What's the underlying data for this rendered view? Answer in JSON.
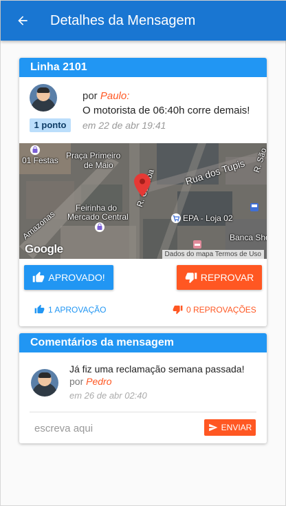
{
  "header": {
    "title": "Detalhes da Mensagem",
    "back_icon": "arrow-back-icon"
  },
  "message_card": {
    "title": "Linha 2101",
    "points_badge": "1 ponto",
    "by_prefix": "por",
    "author": "Paulo:",
    "text": "O motorista de 06:40h corre demais!",
    "date": "em 22 de abr 19:41",
    "map": {
      "labels": {
        "festas": "01 Festas",
        "praca": "Praça Primeiro",
        "praca2": "de Maio",
        "tupis": "Rua dos Tupis",
        "feirinha": "Feirinha do",
        "mercado": "Mercado Central",
        "curitiba": "R. Curitiba",
        "epa": "EPA - Loja 02",
        "banca": "Banca Sho",
        "amazonas": "Amazonas",
        "r_sao": "R. São"
      },
      "logo": "Google",
      "footer": "Dados do mapa   Termos de Uso"
    },
    "approve_button": "Aprovado!",
    "reject_button": "Reprovar",
    "approvals": "1 aprovação",
    "rejections": "0 reprovações"
  },
  "comments_card": {
    "title": "Comentários da mensagem",
    "comments": [
      {
        "text": "Já fiz uma reclamação semana passada!",
        "by_prefix": "por",
        "author": "Pedro",
        "date": "em 26 de abr 02:40"
      }
    ],
    "input_placeholder": "escreva aqui",
    "send_button": "Enviar"
  },
  "colors": {
    "primary": "#1976d2",
    "header": "#2196f3",
    "accent": "#ff5722"
  }
}
